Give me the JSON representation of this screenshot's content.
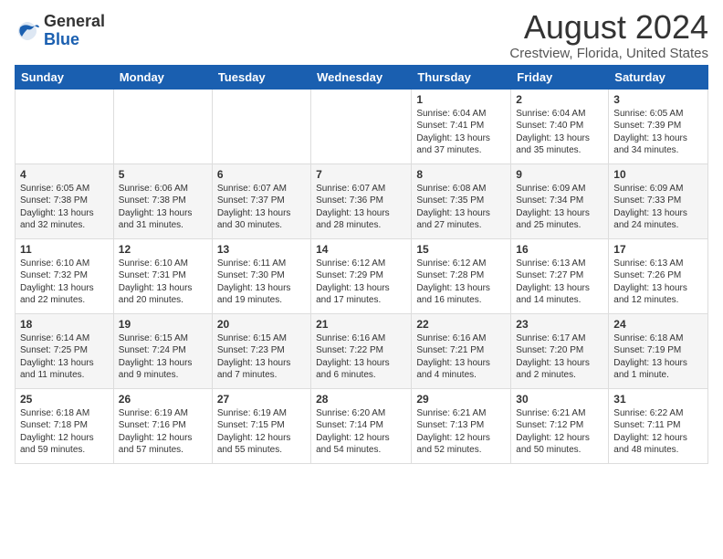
{
  "logo": {
    "general": "General",
    "blue": "Blue"
  },
  "title": "August 2024",
  "location": "Crestview, Florida, United States",
  "days_of_week": [
    "Sunday",
    "Monday",
    "Tuesday",
    "Wednesday",
    "Thursday",
    "Friday",
    "Saturday"
  ],
  "weeks": [
    [
      {
        "day": "",
        "info": ""
      },
      {
        "day": "",
        "info": ""
      },
      {
        "day": "",
        "info": ""
      },
      {
        "day": "",
        "info": ""
      },
      {
        "day": "1",
        "info": "Sunrise: 6:04 AM\nSunset: 7:41 PM\nDaylight: 13 hours\nand 37 minutes."
      },
      {
        "day": "2",
        "info": "Sunrise: 6:04 AM\nSunset: 7:40 PM\nDaylight: 13 hours\nand 35 minutes."
      },
      {
        "day": "3",
        "info": "Sunrise: 6:05 AM\nSunset: 7:39 PM\nDaylight: 13 hours\nand 34 minutes."
      }
    ],
    [
      {
        "day": "4",
        "info": "Sunrise: 6:05 AM\nSunset: 7:38 PM\nDaylight: 13 hours\nand 32 minutes."
      },
      {
        "day": "5",
        "info": "Sunrise: 6:06 AM\nSunset: 7:38 PM\nDaylight: 13 hours\nand 31 minutes."
      },
      {
        "day": "6",
        "info": "Sunrise: 6:07 AM\nSunset: 7:37 PM\nDaylight: 13 hours\nand 30 minutes."
      },
      {
        "day": "7",
        "info": "Sunrise: 6:07 AM\nSunset: 7:36 PM\nDaylight: 13 hours\nand 28 minutes."
      },
      {
        "day": "8",
        "info": "Sunrise: 6:08 AM\nSunset: 7:35 PM\nDaylight: 13 hours\nand 27 minutes."
      },
      {
        "day": "9",
        "info": "Sunrise: 6:09 AM\nSunset: 7:34 PM\nDaylight: 13 hours\nand 25 minutes."
      },
      {
        "day": "10",
        "info": "Sunrise: 6:09 AM\nSunset: 7:33 PM\nDaylight: 13 hours\nand 24 minutes."
      }
    ],
    [
      {
        "day": "11",
        "info": "Sunrise: 6:10 AM\nSunset: 7:32 PM\nDaylight: 13 hours\nand 22 minutes."
      },
      {
        "day": "12",
        "info": "Sunrise: 6:10 AM\nSunset: 7:31 PM\nDaylight: 13 hours\nand 20 minutes."
      },
      {
        "day": "13",
        "info": "Sunrise: 6:11 AM\nSunset: 7:30 PM\nDaylight: 13 hours\nand 19 minutes."
      },
      {
        "day": "14",
        "info": "Sunrise: 6:12 AM\nSunset: 7:29 PM\nDaylight: 13 hours\nand 17 minutes."
      },
      {
        "day": "15",
        "info": "Sunrise: 6:12 AM\nSunset: 7:28 PM\nDaylight: 13 hours\nand 16 minutes."
      },
      {
        "day": "16",
        "info": "Sunrise: 6:13 AM\nSunset: 7:27 PM\nDaylight: 13 hours\nand 14 minutes."
      },
      {
        "day": "17",
        "info": "Sunrise: 6:13 AM\nSunset: 7:26 PM\nDaylight: 13 hours\nand 12 minutes."
      }
    ],
    [
      {
        "day": "18",
        "info": "Sunrise: 6:14 AM\nSunset: 7:25 PM\nDaylight: 13 hours\nand 11 minutes."
      },
      {
        "day": "19",
        "info": "Sunrise: 6:15 AM\nSunset: 7:24 PM\nDaylight: 13 hours\nand 9 minutes."
      },
      {
        "day": "20",
        "info": "Sunrise: 6:15 AM\nSunset: 7:23 PM\nDaylight: 13 hours\nand 7 minutes."
      },
      {
        "day": "21",
        "info": "Sunrise: 6:16 AM\nSunset: 7:22 PM\nDaylight: 13 hours\nand 6 minutes."
      },
      {
        "day": "22",
        "info": "Sunrise: 6:16 AM\nSunset: 7:21 PM\nDaylight: 13 hours\nand 4 minutes."
      },
      {
        "day": "23",
        "info": "Sunrise: 6:17 AM\nSunset: 7:20 PM\nDaylight: 13 hours\nand 2 minutes."
      },
      {
        "day": "24",
        "info": "Sunrise: 6:18 AM\nSunset: 7:19 PM\nDaylight: 13 hours\nand 1 minute."
      }
    ],
    [
      {
        "day": "25",
        "info": "Sunrise: 6:18 AM\nSunset: 7:18 PM\nDaylight: 12 hours\nand 59 minutes."
      },
      {
        "day": "26",
        "info": "Sunrise: 6:19 AM\nSunset: 7:16 PM\nDaylight: 12 hours\nand 57 minutes."
      },
      {
        "day": "27",
        "info": "Sunrise: 6:19 AM\nSunset: 7:15 PM\nDaylight: 12 hours\nand 55 minutes."
      },
      {
        "day": "28",
        "info": "Sunrise: 6:20 AM\nSunset: 7:14 PM\nDaylight: 12 hours\nand 54 minutes."
      },
      {
        "day": "29",
        "info": "Sunrise: 6:21 AM\nSunset: 7:13 PM\nDaylight: 12 hours\nand 52 minutes."
      },
      {
        "day": "30",
        "info": "Sunrise: 6:21 AM\nSunset: 7:12 PM\nDaylight: 12 hours\nand 50 minutes."
      },
      {
        "day": "31",
        "info": "Sunrise: 6:22 AM\nSunset: 7:11 PM\nDaylight: 12 hours\nand 48 minutes."
      }
    ]
  ]
}
